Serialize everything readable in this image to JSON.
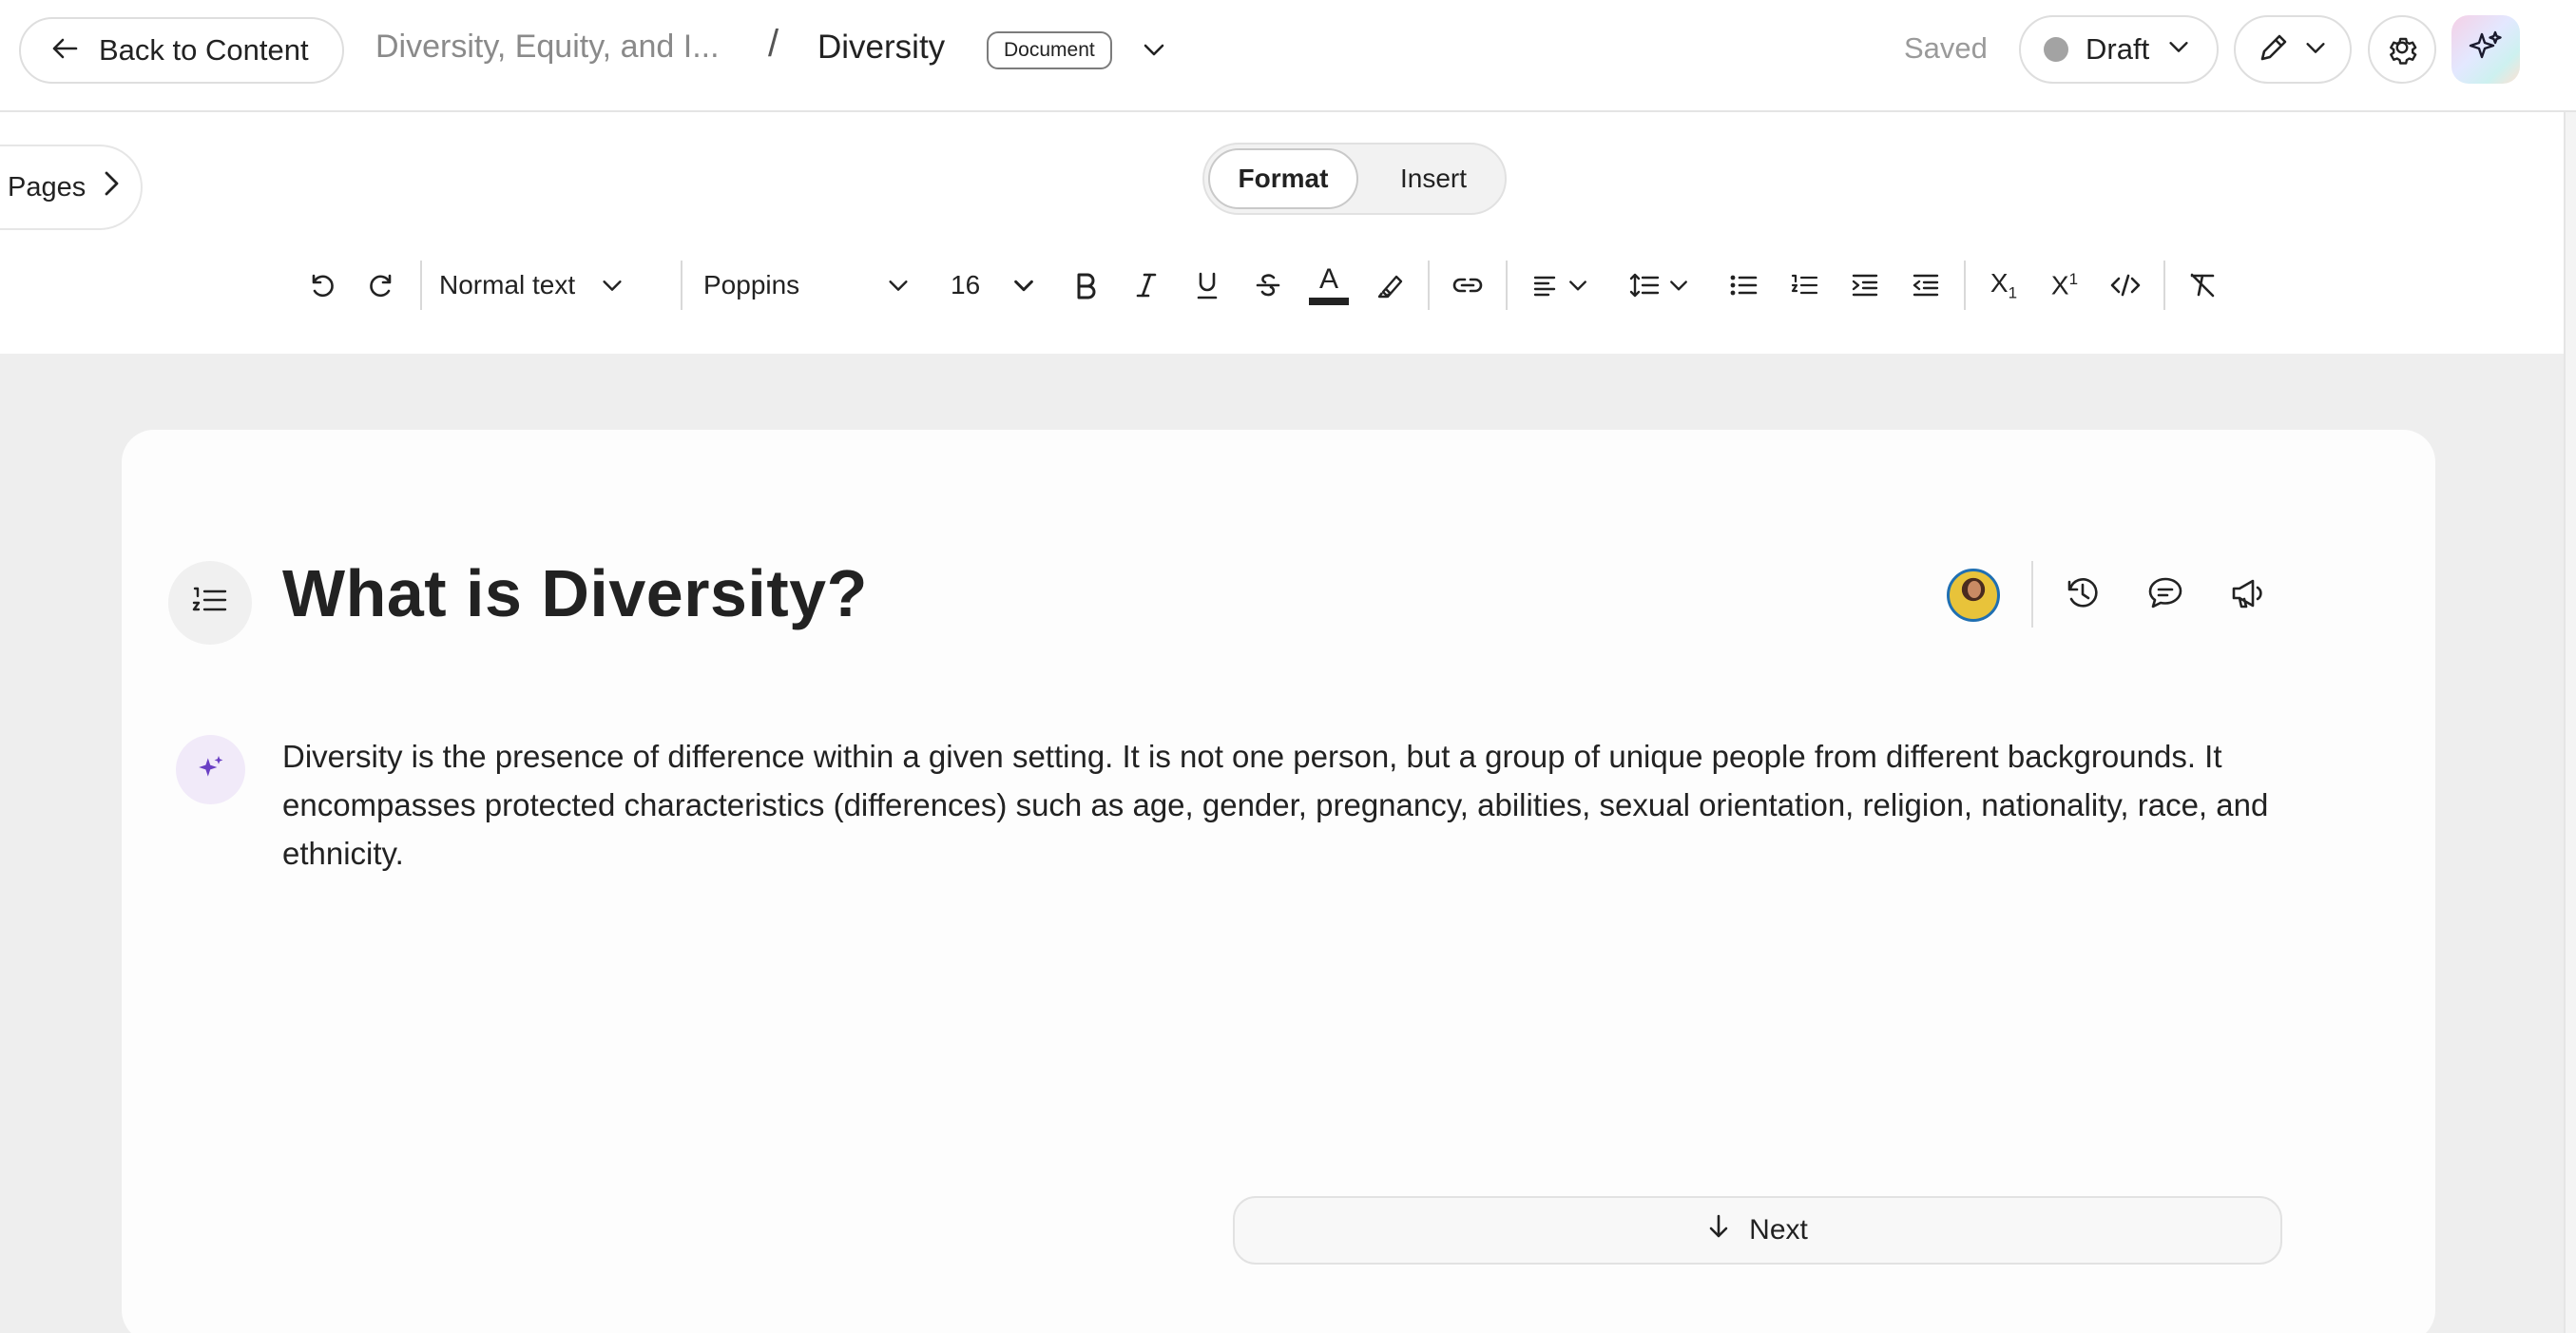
{
  "header": {
    "back_label": "Back to Content",
    "breadcrumb_parent": "Diversity, Equity, and I...",
    "breadcrumb_separator": "/",
    "breadcrumb_current": "Diversity",
    "doc_type_badge": "Document",
    "save_status": "Saved",
    "publish_status": "Draft"
  },
  "toolbar": {
    "pages_label": "Pages",
    "modes": [
      "Format",
      "Insert"
    ],
    "active_mode": "Format",
    "text_style": "Normal text",
    "font_family": "Poppins",
    "font_size": "16",
    "subscript_label": "X",
    "subscript_sub": "1",
    "superscript_label": "X",
    "superscript_sup": "1",
    "text_color_letter": "A"
  },
  "content": {
    "title": "What is Diversity?",
    "body": "Diversity is the presence of difference within a given setting. It is not one person, but a group of unique people from different backgrounds. It encompasses protected characteristics (differences) such as age, gender, pregnancy, abilities, sexual orientation, religion, nationality, race, and ethnicity.",
    "next_label": "Next"
  },
  "colors": {
    "accent_purple": "#6a3fc4",
    "avatar_ring": "#1f6fb2",
    "canvas_bg": "#eeeeee",
    "draft_dot": "#a3a3a3"
  },
  "icons": [
    "arrow-left-icon",
    "chevron-down-icon",
    "pencil-icon",
    "gear-icon",
    "sparkle-icon",
    "chevron-right-icon",
    "undo-icon",
    "redo-icon",
    "bold-icon",
    "italic-icon",
    "underline-icon",
    "strikethrough-icon",
    "text-color-icon",
    "highlighter-icon",
    "link-icon",
    "align-left-icon",
    "line-spacing-icon",
    "bullet-list-icon",
    "numbered-list-icon",
    "indent-icon",
    "outdent-icon",
    "subscript-icon",
    "superscript-icon",
    "code-icon",
    "clear-format-icon",
    "numbered-outline-icon",
    "history-icon",
    "comment-icon",
    "megaphone-icon",
    "arrow-down-icon"
  ]
}
